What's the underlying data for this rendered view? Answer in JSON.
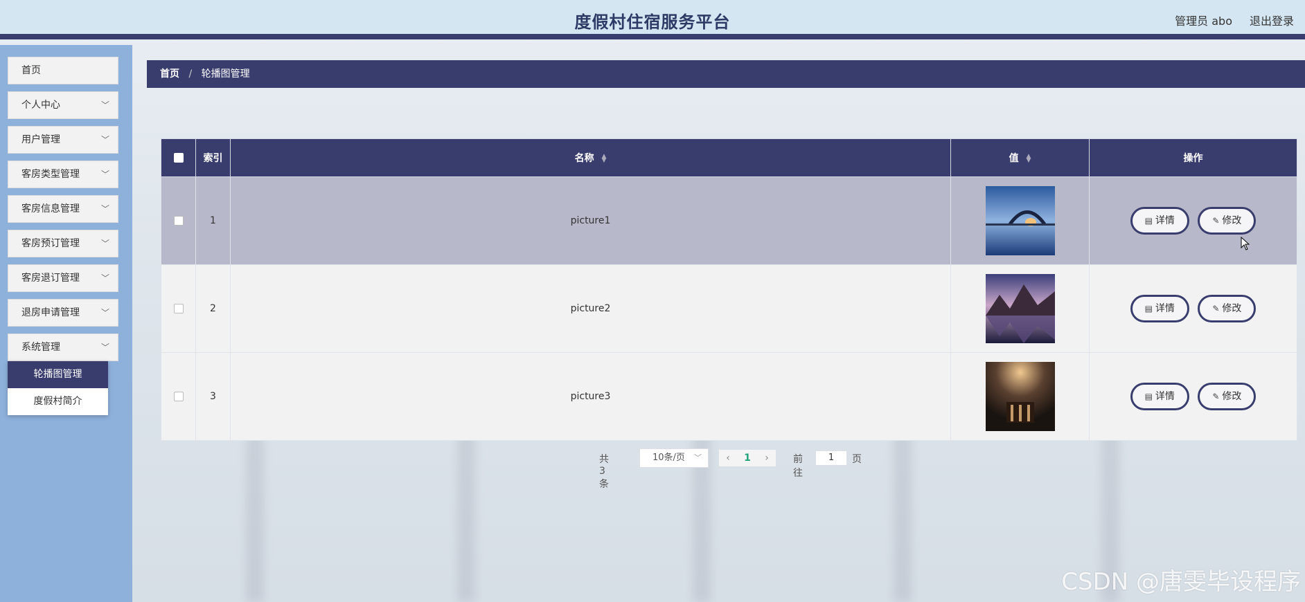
{
  "header": {
    "title": "度假村住宿服务平台",
    "user_label": "管理员 abo",
    "logout_label": "退出登录"
  },
  "sidebar": {
    "items": [
      {
        "label": "首页"
      },
      {
        "label": "个人中心"
      },
      {
        "label": "用户管理"
      },
      {
        "label": "客房类型管理"
      },
      {
        "label": "客房信息管理"
      },
      {
        "label": "客房预订管理"
      },
      {
        "label": "客房退订管理"
      },
      {
        "label": "退房申请管理"
      },
      {
        "label": "系统管理"
      }
    ],
    "submenu": [
      {
        "label": "轮播图管理",
        "active": true
      },
      {
        "label": "度假村简介",
        "active": false
      }
    ]
  },
  "breadcrumb": {
    "home": "首页",
    "separator": "/",
    "current": "轮播图管理"
  },
  "table": {
    "columns": {
      "index": "索引",
      "name": "名称",
      "value": "值",
      "actions": "操作"
    },
    "rows": [
      {
        "index": "1",
        "name": "picture1",
        "image": "bridge-sunset"
      },
      {
        "index": "2",
        "name": "picture2",
        "image": "mountain-lake"
      },
      {
        "index": "3",
        "name": "picture3",
        "image": "pier-dusk"
      }
    ],
    "detail_label": "详情",
    "edit_label": "修改"
  },
  "pagination": {
    "total": "共 3 条",
    "page_size": "10条/页",
    "current_page": "1",
    "goto_label": "前往",
    "goto_value": "1",
    "page_unit": "页"
  },
  "watermark": "CSDN @唐雯毕设程序",
  "colors": {
    "primary": "#383d6e",
    "sidebar": "#8eb1dc",
    "header": "#d4e6f1",
    "row_hover": "#b7b8ca"
  }
}
